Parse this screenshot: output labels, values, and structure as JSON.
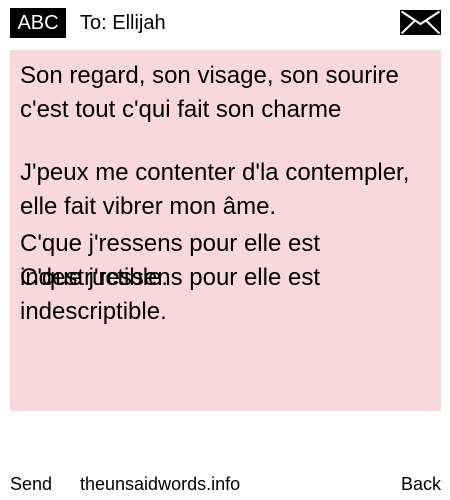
{
  "header": {
    "badge_label": "ABC",
    "recipient": "To: Ellijah",
    "mail_icon": "envelope-icon"
  },
  "message": {
    "lines": [
      "Son regard, son visage, son sourire c'est tout c'qui fait son charme",
      "J'peux me contenter d'la contempler, elle fait vibrer mon âme.",
      "C'que j'ressens pour elle est indestructible.",
      "C'que j'ressens pour elle est indescriptible."
    ],
    "background_color": "#f8d8dc"
  },
  "softkeys": {
    "left": "Send",
    "center": "theunsaidwords.info",
    "right": "Back"
  }
}
